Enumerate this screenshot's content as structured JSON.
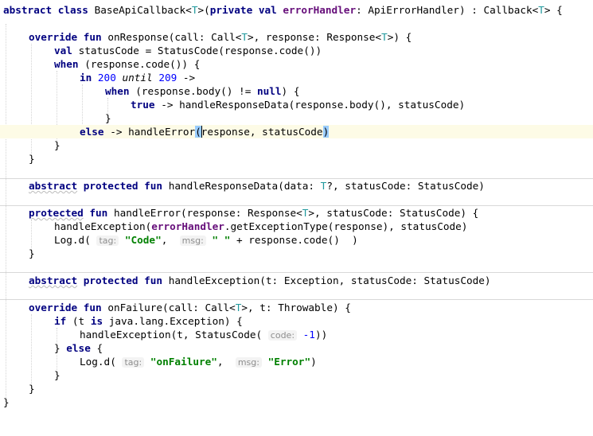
{
  "editor": {
    "l1": {
      "kw1": "abstract",
      "kw2": "class",
      "name": "BaseApiCallback<",
      "tparam": "T",
      "open": ">(",
      "kw3": "private",
      "kw4": "val",
      "prop": "errorHandler",
      "rest": ": ApiErrorHandler) : Callback<",
      "tparam2": "T",
      "end": "> {"
    },
    "l2": {
      "kw1": "override",
      "kw2": "fun",
      "a": "onResponse(call: Call<",
      "t1": "T",
      "b": ">, response: Response<",
      "t2": "T",
      "c": ">) {"
    },
    "l3": {
      "kw": "val",
      "rest": "statusCode = StatusCode(response.code())"
    },
    "l4": {
      "kw": "when",
      "rest": "(response.code()) {"
    },
    "l5": {
      "kw": "in",
      "n1": "200",
      "until": "until",
      "n2": "209",
      "rest": "->"
    },
    "l6": {
      "kw": "when",
      "a": "(response.body() != ",
      "kw2": "null",
      "b": ") {"
    },
    "l7": {
      "kw": "true",
      "rest": "-> handleResponseData(response.body(), statusCode)"
    },
    "l8": {
      "text": "}"
    },
    "l9": {
      "kw": "else",
      "a": "-> handleError",
      "p1": "(",
      "b": "response, statusCode",
      "p2": ")"
    },
    "l10": {
      "text": "}"
    },
    "l11": {
      "text": "}"
    },
    "l12": {
      "kw1": "abstract",
      "kw2": "protected",
      "kw3": "fun",
      "a": "handleResponseData(data: ",
      "t": "T",
      "b": "?, statusCode: StatusCode)"
    },
    "l13": {
      "kw1": "protected",
      "kw2": "fun",
      "a": "handleError(response: Response<",
      "t": "T",
      "b": ">, statusCode: StatusCode) {"
    },
    "l14": {
      "a": "handleException(",
      "prop": "errorHandler",
      "b": ".getExceptionType(response), statusCode)"
    },
    "l15": {
      "a": "Log.d(",
      "h1": "tag:",
      "s1": "\"Code\"",
      "c": ",",
      "h2": "msg:",
      "s2": "\" \"",
      "b": "+ response.code()  )"
    },
    "l16": {
      "text": "}"
    },
    "l17": {
      "kw1": "abstract",
      "kw2": "protected",
      "kw3": "fun",
      "a": "handleException(t: Exception, statusCode: StatusCode)"
    },
    "l18": {
      "kw1": "override",
      "kw2": "fun",
      "a": "onFailure(call: Call<",
      "t": "T",
      "b": ">, t: Throwable) {"
    },
    "l19": {
      "kw": "if",
      "a": "(t ",
      "kw2": "is",
      "b": "java.lang.Exception) {"
    },
    "l20": {
      "a": "handleException(t, StatusCode(",
      "h": "code:",
      "n": "-1",
      "b": "))"
    },
    "l21": {
      "text": "}",
      "kw": "else",
      "b": "{"
    },
    "l22": {
      "a": "Log.d(",
      "h1": "tag:",
      "s1": "\"onFailure\"",
      "c": ",",
      "h2": "msg:",
      "s2": "\"Error\"",
      "b": ")"
    },
    "l23": {
      "text": "}"
    },
    "l24": {
      "text": "}"
    },
    "l25": {
      "text": "}"
    }
  },
  "colors": {
    "keyword": "#000080",
    "type_param": "#20999d",
    "property": "#660e7a",
    "number": "#0000ff",
    "string": "#008000",
    "current_line": "#fdfbe6",
    "brace_match": "#99ccff"
  }
}
